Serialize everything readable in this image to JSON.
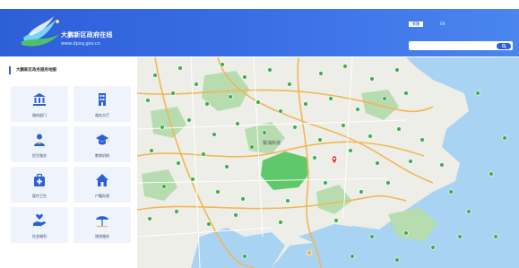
{
  "header": {
    "site_name": "大鹏新区政府在线",
    "site_url": "www.dpxq.gov.cn",
    "lang_current": "繁體",
    "lang_alt": "EN",
    "search_placeholder": ""
  },
  "panel": {
    "title": "大鹏新区政务服务地图",
    "tiles": [
      {
        "label": "政府部门",
        "icon": "government-building-icon"
      },
      {
        "label": "政务大厅",
        "icon": "office-tower-icon"
      },
      {
        "label": "民生服务",
        "icon": "person-service-icon"
      },
      {
        "label": "教育机构",
        "icon": "graduation-cap-icon"
      },
      {
        "label": "医疗卫生",
        "icon": "medical-kit-icon"
      },
      {
        "label": "户籍办理",
        "icon": "home-icon"
      },
      {
        "label": "社会福利",
        "icon": "hand-care-icon"
      },
      {
        "label": "旅游服务",
        "icon": "beach-umbrella-icon"
      }
    ]
  },
  "map": {
    "city_label": "葵涌街道",
    "colors": {
      "land": "#eeeee8",
      "sea": "#a9d3f2",
      "park": "#b7dcb0",
      "highlight": "#5fc86a",
      "road": "#f1b655",
      "marker": "#3fae52",
      "pin": "#e03a3a"
    }
  }
}
